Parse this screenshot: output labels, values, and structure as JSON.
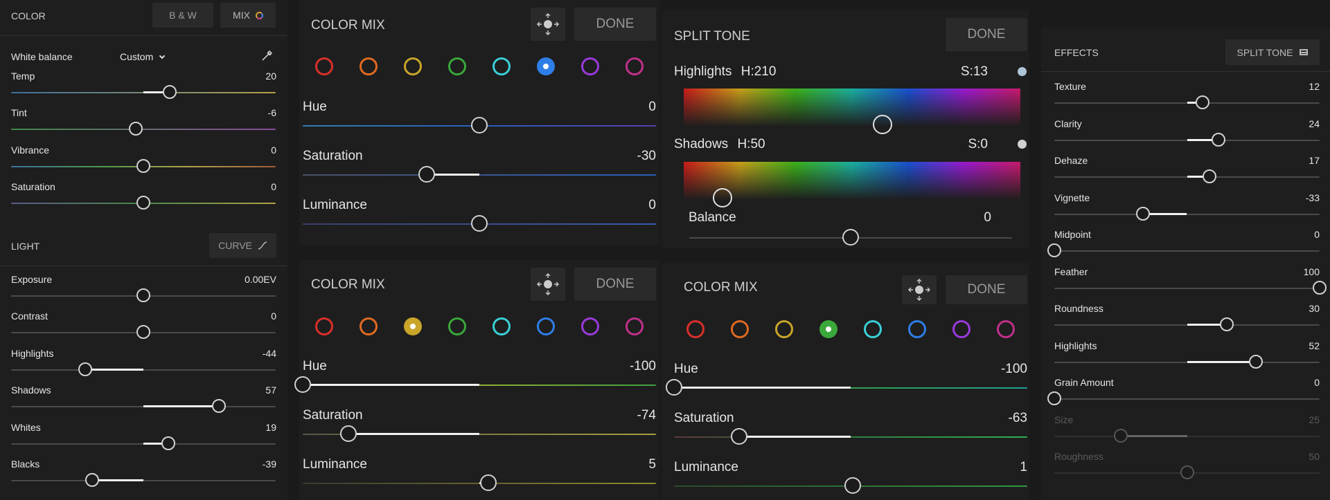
{
  "left": {
    "color_title": "COLOR",
    "bw_label": "B & W",
    "mix_label": "MIX",
    "wb_label": "White balance",
    "wb_value": "Custom",
    "color_sliders": [
      {
        "label": "Temp",
        "value": "20",
        "pos": 0.6,
        "gradient": "#3d6fa0,#b3a24a"
      },
      {
        "label": "Tint",
        "value": "-6",
        "pos": 0.47,
        "gradient": "#3f8a48,#8a4a9a"
      },
      {
        "label": "Vibrance",
        "value": "0",
        "pos": 0.5,
        "gradient": "#3d6fa0,#4a9a4a,#b3a24a,#a05a3a"
      },
      {
        "label": "Saturation",
        "value": "0",
        "pos": 0.5,
        "gradient": "#5a5a8a,#4a8a4a,#b3a24a"
      }
    ],
    "light_title": "LIGHT",
    "curve_label": "CURVE",
    "light_sliders": [
      {
        "label": "Exposure",
        "value": "0.00EV",
        "pos": 0.5
      },
      {
        "label": "Contrast",
        "value": "0",
        "pos": 0.5
      },
      {
        "label": "Highlights",
        "value": "-44",
        "pos": 0.28
      },
      {
        "label": "Shadows",
        "value": "57",
        "pos": 0.785
      },
      {
        "label": "Whites",
        "value": "19",
        "pos": 0.595
      },
      {
        "label": "Blacks",
        "value": "-39",
        "pos": 0.305
      }
    ]
  },
  "mix1": {
    "title": "COLOR MIX",
    "done": "DONE",
    "selected": 5,
    "sliders": [
      {
        "label": "Hue",
        "value": "0",
        "pos": 0.5,
        "gradient": "#2f7fb0,#2a5ec0,#5a3eb0"
      },
      {
        "label": "Saturation",
        "value": "-30",
        "pos": 0.35,
        "gradient": "#4a4f66,#2a5ec0"
      },
      {
        "label": "Luminance",
        "value": "0",
        "pos": 0.5,
        "gradient": "#3a3f6a,#3a5ab0"
      }
    ]
  },
  "mix2": {
    "title": "COLOR MIX",
    "done": "DONE",
    "selected": 2,
    "sliders": [
      {
        "label": "Hue",
        "value": "-100",
        "pos": 0.0,
        "gradient": "#c6a030,#8fb033,#3fa040"
      },
      {
        "label": "Saturation",
        "value": "-74",
        "pos": 0.13,
        "gradient": "#5a5646,#a8a040"
      },
      {
        "label": "Luminance",
        "value": "5",
        "pos": 0.525,
        "gradient": "#3b3a2e,#8f8a30"
      }
    ]
  },
  "mix3": {
    "title": "COLOR MIX",
    "done": "DONE",
    "selected": 3,
    "sliders": [
      {
        "label": "Hue",
        "value": "-100",
        "pos": 0.0,
        "gradient": "#8fb033,#30a050,#20a090"
      },
      {
        "label": "Saturation",
        "value": "-63",
        "pos": 0.185,
        "gradient": "#5a3a3a,#2f8040,#30b050"
      },
      {
        "label": "Luminance",
        "value": "1",
        "pos": 0.505,
        "gradient": "#2a4a2a,#2f9a40"
      }
    ]
  },
  "hues": [
    "#d8302a",
    "#e06a20",
    "#c9a52a",
    "#3aa83a",
    "#3ad0d8",
    "#2e7ee8",
    "#9a3adc",
    "#c0308a"
  ],
  "split": {
    "title": "SPLIT TONE",
    "done": "DONE",
    "highlights_label": "Highlights",
    "highlights_h": "H:210",
    "highlights_s": "S:13",
    "shadows_label": "Shadows",
    "shadows_h": "H:50",
    "shadows_s": "S:0",
    "balance_label": "Balance",
    "balance_value": "0",
    "balance_pos": 0.5
  },
  "effects": {
    "title": "EFFECTS",
    "button": "SPLIT TONE",
    "sliders": [
      {
        "label": "Texture",
        "value": "12",
        "pos": 0.56,
        "enabled": true
      },
      {
        "label": "Clarity",
        "value": "24",
        "pos": 0.62,
        "enabled": true
      },
      {
        "label": "Dehaze",
        "value": "17",
        "pos": 0.585,
        "enabled": true
      },
      {
        "label": "Vignette",
        "value": "-33",
        "pos": 0.335,
        "enabled": true
      },
      {
        "label": "Midpoint",
        "value": "0",
        "pos": 0.0,
        "enabled": true
      },
      {
        "label": "Feather",
        "value": "100",
        "pos": 1.0,
        "enabled": true
      },
      {
        "label": "Roundness",
        "value": "30",
        "pos": 0.65,
        "enabled": true
      },
      {
        "label": "Highlights",
        "value": "52",
        "pos": 0.76,
        "enabled": true
      },
      {
        "label": "Grain Amount",
        "value": "0",
        "pos": 0.0,
        "enabled": true
      },
      {
        "label": "Size",
        "value": "25",
        "pos": 0.25,
        "enabled": false
      },
      {
        "label": "Roughness",
        "value": "50",
        "pos": 0.5,
        "enabled": false
      }
    ]
  }
}
